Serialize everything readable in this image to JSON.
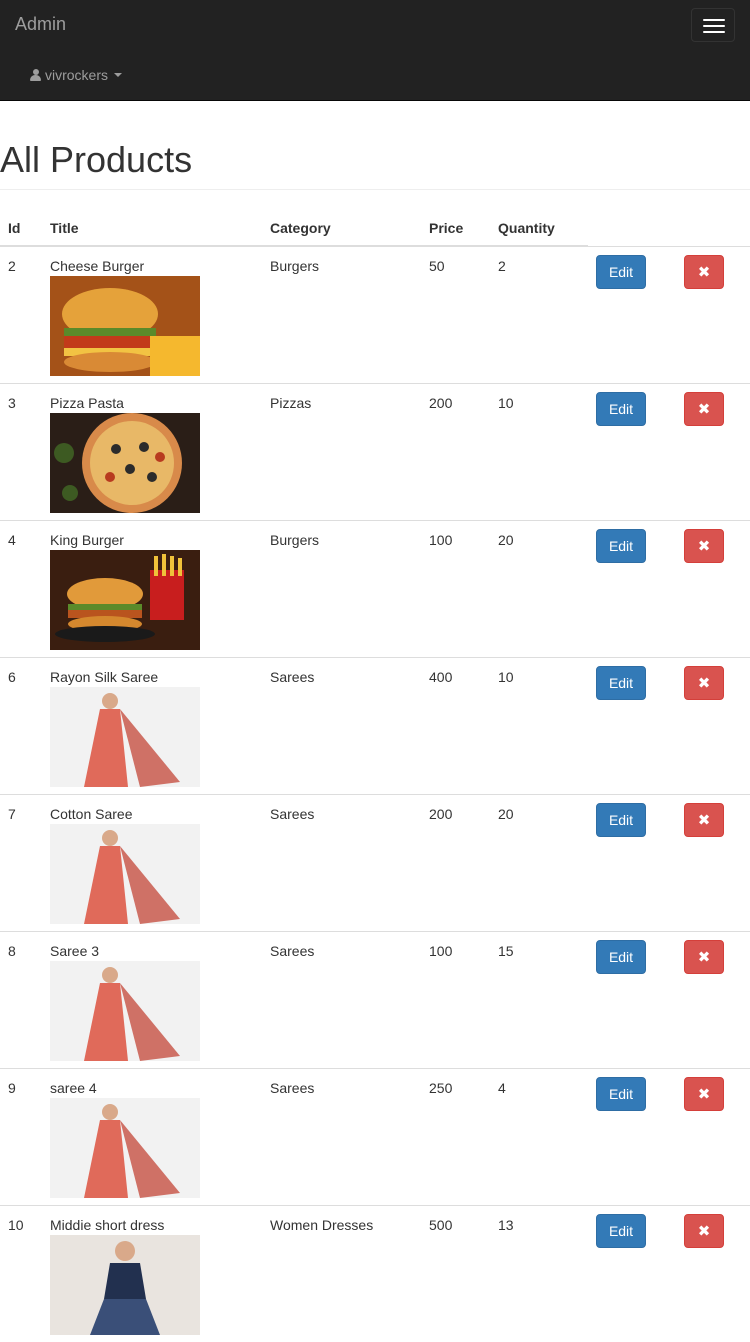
{
  "navbar": {
    "brand": "Admin",
    "user": "vivrockers"
  },
  "page": {
    "title": "All Products"
  },
  "table": {
    "headers": [
      "Id",
      "Title",
      "Category",
      "Price",
      "Quantity"
    ],
    "edit_label": "Edit",
    "delete_label": "✖",
    "rows": [
      {
        "id": "2",
        "title": "Cheese Burger",
        "category": "Burgers",
        "price": "50",
        "quantity": "2",
        "image": "burger"
      },
      {
        "id": "3",
        "title": "Pizza Pasta",
        "category": "Pizzas",
        "price": "200",
        "quantity": "10",
        "image": "pizza"
      },
      {
        "id": "4",
        "title": "King Burger",
        "category": "Burgers",
        "price": "100",
        "quantity": "20",
        "image": "burger-fries"
      },
      {
        "id": "6",
        "title": "Rayon Silk Saree",
        "category": "Sarees",
        "price": "400",
        "quantity": "10",
        "image": "saree"
      },
      {
        "id": "7",
        "title": "Cotton Saree",
        "category": "Sarees",
        "price": "200",
        "quantity": "20",
        "image": "saree"
      },
      {
        "id": "8",
        "title": "Saree 3",
        "category": "Sarees",
        "price": "100",
        "quantity": "15",
        "image": "saree"
      },
      {
        "id": "9",
        "title": "saree 4",
        "category": "Sarees",
        "price": "250",
        "quantity": "4",
        "image": "saree"
      },
      {
        "id": "10",
        "title": "Middie short dress",
        "category": "Women Dresses",
        "price": "500",
        "quantity": "13",
        "image": "dress"
      }
    ]
  }
}
